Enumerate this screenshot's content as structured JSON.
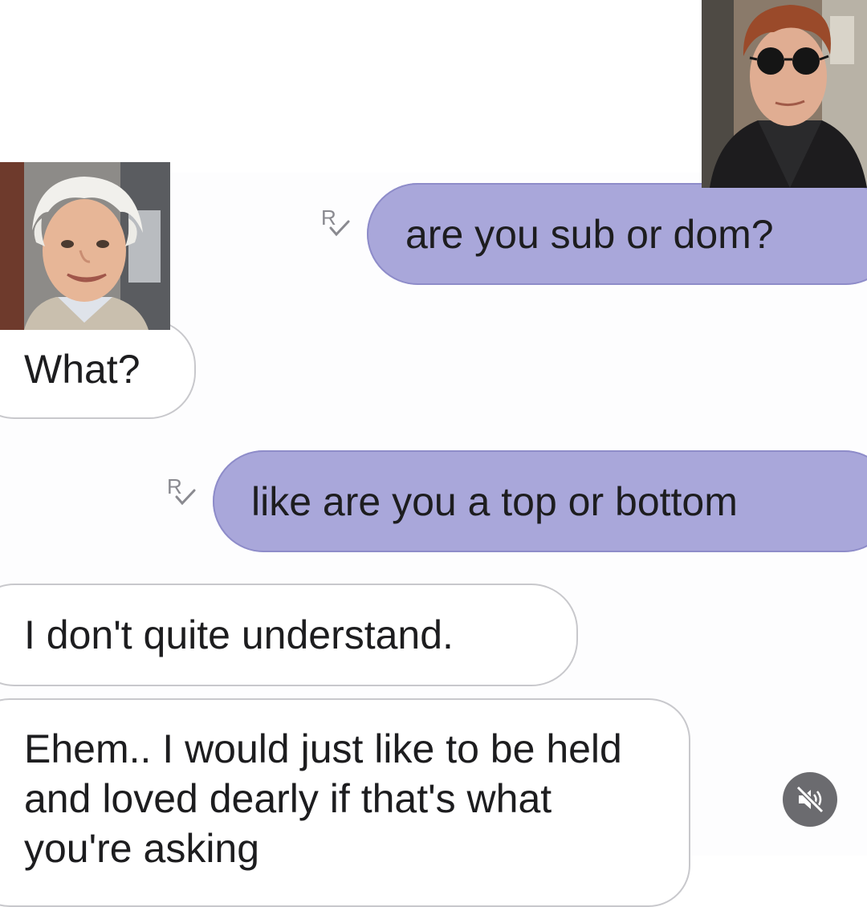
{
  "chat": {
    "messages": [
      {
        "direction": "outgoing",
        "text": "are you sub or dom?",
        "read_receipt": "read-receipt-icon"
      },
      {
        "direction": "incoming",
        "text": "What?"
      },
      {
        "direction": "outgoing",
        "text": "like are you a top or bottom",
        "read_receipt": "read-receipt-icon"
      },
      {
        "direction": "incoming",
        "text": "I don't quite understand."
      },
      {
        "direction": "incoming",
        "text": "Ehem.. I would just like to be held and loved dearly if that's what you're asking"
      }
    ]
  },
  "overlays": {
    "avatar_left": "avatar-photo-white-haired-man",
    "avatar_right": "avatar-photo-man-with-sunglasses"
  },
  "controls": {
    "mute_icon": "speaker-muted-icon"
  },
  "colors": {
    "outgoing_bubble": "#a9a7da",
    "incoming_bubble": "#ffffff",
    "incoming_border": "#c8c8cc",
    "mute_button": "#6b6b6f"
  }
}
